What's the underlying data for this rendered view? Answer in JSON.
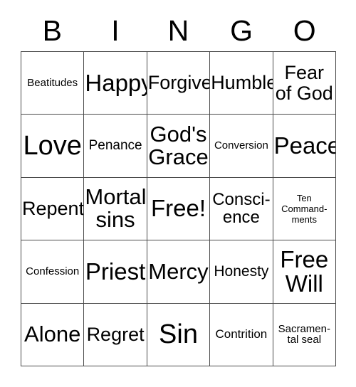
{
  "card": {
    "header_letters": [
      "B",
      "I",
      "N",
      "G",
      "O"
    ],
    "columns": 5,
    "rows": 5,
    "free_space": "Free!",
    "colors": {
      "background": "#ffffff",
      "text": "#000000",
      "grid_line": "#4a4a4a"
    },
    "cells": [
      [
        {
          "label": "Beatitudes",
          "size": "sz-s"
        },
        {
          "label": "Happy",
          "size": "sz-3xl"
        },
        {
          "label": "Forgive",
          "size": "sz-xl"
        },
        {
          "label": "Humble",
          "size": "sz-xl"
        },
        {
          "label": "Fear\nof God",
          "size": "sz-xl"
        }
      ],
      [
        {
          "label": "Love",
          "size": "sz-4xl"
        },
        {
          "label": "Penance",
          "size": "sz-m"
        },
        {
          "label": "God's\nGrace",
          "size": "sz-xxl"
        },
        {
          "label": "Conversion",
          "size": "sz-s"
        },
        {
          "label": "Peace",
          "size": "sz-3xl"
        }
      ],
      [
        {
          "label": "Repent",
          "size": "sz-xl"
        },
        {
          "label": "Mortal\nsins",
          "size": "sz-xxl"
        },
        {
          "label": "Free!",
          "size": "sz-3xl"
        },
        {
          "label": "Consci-\nence",
          "size": "sz-l"
        },
        {
          "label": "Ten\nCommand-\nments",
          "size": "sz-xs"
        }
      ],
      [
        {
          "label": "Confession",
          "size": "sz-s"
        },
        {
          "label": "Priest",
          "size": "sz-3xl"
        },
        {
          "label": "Mercy",
          "size": "sz-xxl"
        },
        {
          "label": "Honesty",
          "size": "sz-ml"
        },
        {
          "label": "Free\nWill",
          "size": "sz-3xl"
        }
      ],
      [
        {
          "label": "Alone",
          "size": "sz-xxl"
        },
        {
          "label": "Regret",
          "size": "sz-xl"
        },
        {
          "label": "Sin",
          "size": "sz-4xl"
        },
        {
          "label": "Contrition",
          "size": "sz-sm"
        },
        {
          "label": "Sacramen-\ntal seal",
          "size": "sz-s"
        }
      ]
    ]
  }
}
